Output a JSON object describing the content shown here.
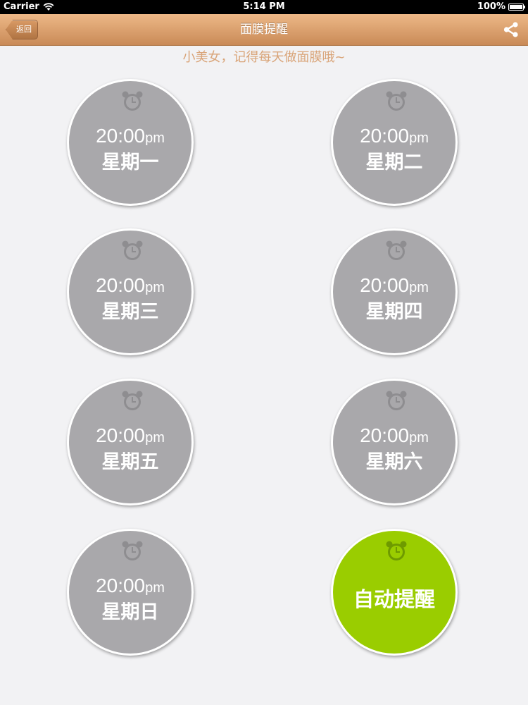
{
  "status_bar": {
    "carrier": "Carrier",
    "time": "5:14 PM",
    "battery": "100%",
    "battery_level": 1.0
  },
  "nav": {
    "back_label": "返回",
    "title": "面膜提醒",
    "share_icon": "share-icon"
  },
  "subtitle": "小美女，记得每天做面膜哦~",
  "days": [
    {
      "time": "20:00",
      "ampm": "pm",
      "day": "星期一"
    },
    {
      "time": "20:00",
      "ampm": "pm",
      "day": "星期二"
    },
    {
      "time": "20:00",
      "ampm": "pm",
      "day": "星期三"
    },
    {
      "time": "20:00",
      "ampm": "pm",
      "day": "星期四"
    },
    {
      "time": "20:00",
      "ampm": "pm",
      "day": "星期五"
    },
    {
      "time": "20:00",
      "ampm": "pm",
      "day": "星期六"
    },
    {
      "time": "20:00",
      "ampm": "pm",
      "day": "星期日"
    }
  ],
  "auto_remind": {
    "label": "自动提醒"
  },
  "colors": {
    "nav_brown": "#d9a06e",
    "circle_gray": "#a9a8ab",
    "auto_green": "#9acd00",
    "subtitle_tan": "#d9a478"
  }
}
